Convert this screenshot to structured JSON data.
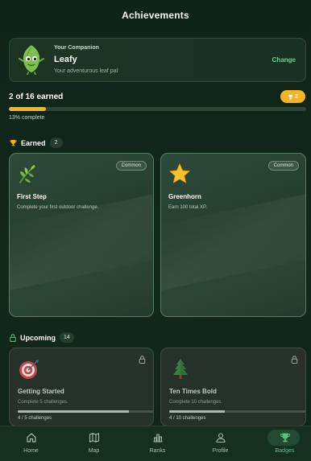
{
  "header": {
    "title": "Achievements"
  },
  "companion": {
    "eyebrow": "Your Companion",
    "name": "Leafy",
    "description": "Your adventurous leaf pal",
    "change_label": "Change"
  },
  "summary": {
    "earned_text": "2 of 16 earned",
    "badge_count": "2",
    "progress_fraction": 0.125,
    "progress_text": "13% complete"
  },
  "earned_section": {
    "title": "Earned",
    "count": "2",
    "cards": [
      {
        "icon": "herb-leaf-icon",
        "rarity": "Common",
        "title": "First Step",
        "description": "Complete your first outdoor challenge."
      },
      {
        "icon": "star-icon",
        "rarity": "Common",
        "title": "Greenhorn",
        "description": "Earn 100 total XP."
      }
    ]
  },
  "upcoming_section": {
    "title": "Upcoming",
    "count": "14",
    "cards": [
      {
        "icon": "target-icon",
        "title": "Getting Started",
        "description": "Complete 5 challenges.",
        "progress_text": "4 / 5 challenges",
        "progress_fraction": 0.8
      },
      {
        "icon": "pine-tree-icon",
        "title": "Ten Times Bold",
        "description": "Complete 10 challenges.",
        "progress_text": "4 / 10 challenges",
        "progress_fraction": 0.4
      }
    ]
  },
  "nav": {
    "items": [
      {
        "label": "Home",
        "icon": "home-icon"
      },
      {
        "label": "Map",
        "icon": "map-icon"
      },
      {
        "label": "Ranks",
        "icon": "ranks-icon"
      },
      {
        "label": "Profile",
        "icon": "profile-icon"
      },
      {
        "label": "Badges",
        "icon": "trophy-icon",
        "active": true
      }
    ]
  },
  "colors": {
    "background": "#12281b",
    "accent_green": "#5fbf7f",
    "gold": "#f3b526"
  }
}
